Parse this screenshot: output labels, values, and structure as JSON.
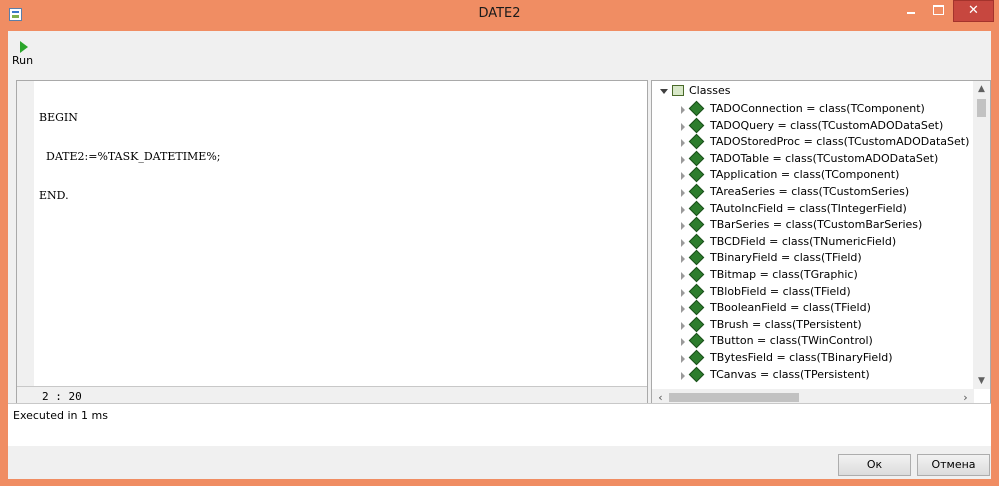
{
  "window": {
    "title": "DATE2"
  },
  "toolbar": {
    "run_label": "Run",
    "run_icon": "play-icon"
  },
  "editor": {
    "lines": [
      "BEGIN",
      "  DATE2:=%TASK_DATETIME%;",
      "END."
    ],
    "cursor_position": "2 : 20"
  },
  "class_tree": {
    "root_label": "Classes",
    "items": [
      "TADOConnection = class(TComponent)",
      "TADOQuery = class(TCustomADODataSet)",
      "TADOStoredProc = class(TCustomADODataSet)",
      "TADOTable = class(TCustomADODataSet)",
      "TApplication = class(TComponent)",
      "TAreaSeries = class(TCustomSeries)",
      "TAutoIncField = class(TIntegerField)",
      "TBarSeries = class(TCustomBarSeries)",
      "TBCDField = class(TNumericField)",
      "TBinaryField = class(TField)",
      "TBitmap = class(TGraphic)",
      "TBlobField = class(TField)",
      "TBooleanField = class(TField)",
      "TBrush = class(TPersistent)",
      "TButton = class(TWinControl)",
      "TBytesField = class(TBinaryField)",
      "TCanvas = class(TPersistent)"
    ]
  },
  "output": {
    "text": "Executed in 1 ms"
  },
  "buttons": {
    "ok_label": "Ок",
    "cancel_label": "Отмена"
  },
  "colors": {
    "title_bar": "#f08d63",
    "close_button": "#c7473f",
    "class_icon": "#2d7d2d",
    "run_icon": "#2aa52a"
  }
}
